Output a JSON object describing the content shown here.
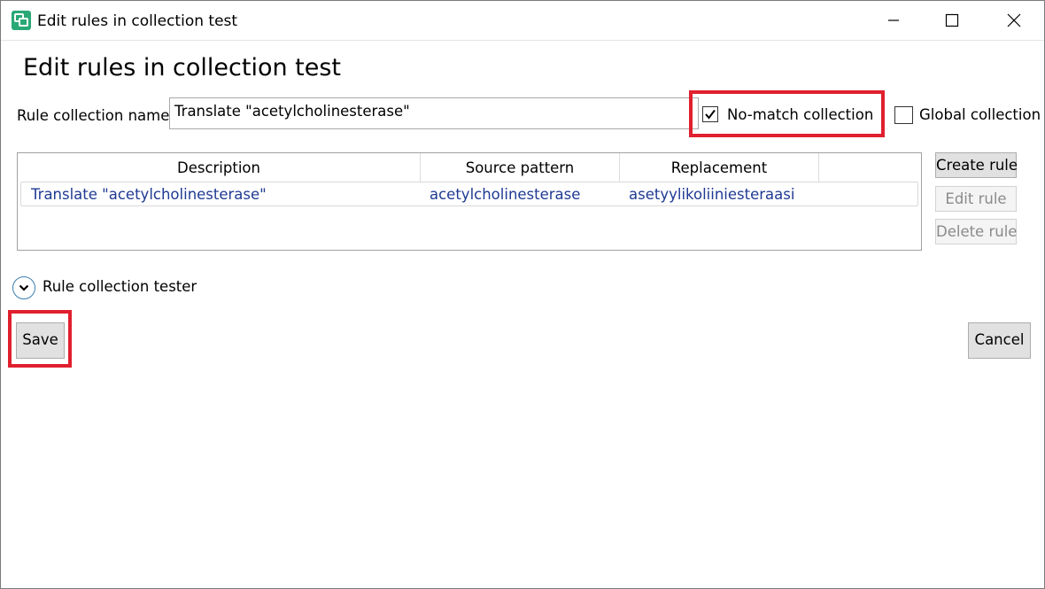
{
  "window": {
    "title": "Edit rules in collection test",
    "controls": {
      "minimize": "minimize-icon",
      "maximize": "maximize-icon",
      "close": "close-icon"
    }
  },
  "heading": "Edit rules in collection test",
  "form": {
    "name_label": "Rule collection name",
    "name_value": "Translate \"acetylcholinesterase\"",
    "no_match": {
      "label": "No-match collection",
      "checked": true
    },
    "global": {
      "label": "Global collection",
      "checked": false
    }
  },
  "grid": {
    "columns": [
      "Description",
      "Source pattern",
      "Replacement"
    ],
    "rows": [
      {
        "description": "Translate \"acetylcholinesterase\"",
        "source": "acetylcholinesterase",
        "replacement": "asetyylikoliiniesteraasi"
      }
    ]
  },
  "side_buttons": {
    "create": {
      "label": "Create rule",
      "enabled": true
    },
    "edit": {
      "label": "Edit rule",
      "enabled": false
    },
    "delete": {
      "label": "Delete rule",
      "enabled": false
    }
  },
  "tester": {
    "label": "Rule collection tester",
    "icon": "chevron-down-icon"
  },
  "actions": {
    "save": "Save",
    "cancel": "Cancel"
  },
  "colors": {
    "highlight": "#e0202e",
    "link_text": "#1f3a93",
    "accent": "#3c7fb1",
    "app_icon": "#2aa876"
  }
}
